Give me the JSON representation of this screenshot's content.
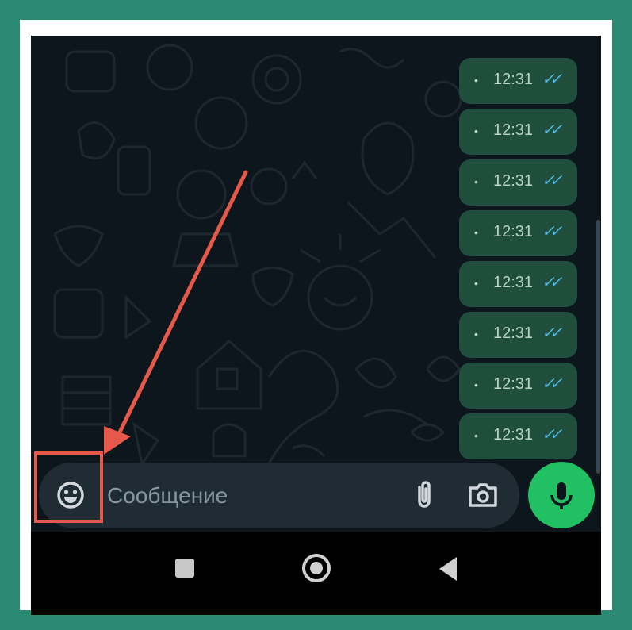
{
  "messages": [
    {
      "time": "12:31",
      "status": "read"
    },
    {
      "time": "12:31",
      "status": "read"
    },
    {
      "time": "12:31",
      "status": "read"
    },
    {
      "time": "12:31",
      "status": "read"
    },
    {
      "time": "12:31",
      "status": "read"
    },
    {
      "time": "12:31",
      "status": "read"
    },
    {
      "time": "12:31",
      "status": "read"
    },
    {
      "time": "12:31",
      "status": "read"
    }
  ],
  "composer": {
    "placeholder": "Сообщение",
    "icons": [
      "emoji-icon",
      "attach-icon",
      "camera-icon",
      "microphone-icon"
    ]
  },
  "navigation": {
    "buttons": [
      "recents",
      "home",
      "back"
    ]
  },
  "colors": {
    "outer_background": "#2b8a73",
    "chat_background": "#0d161c",
    "bubble": "#1f4e3c",
    "read_check": "#53bdeb",
    "mic_button": "#21c063",
    "annotation": "#e5584a"
  }
}
